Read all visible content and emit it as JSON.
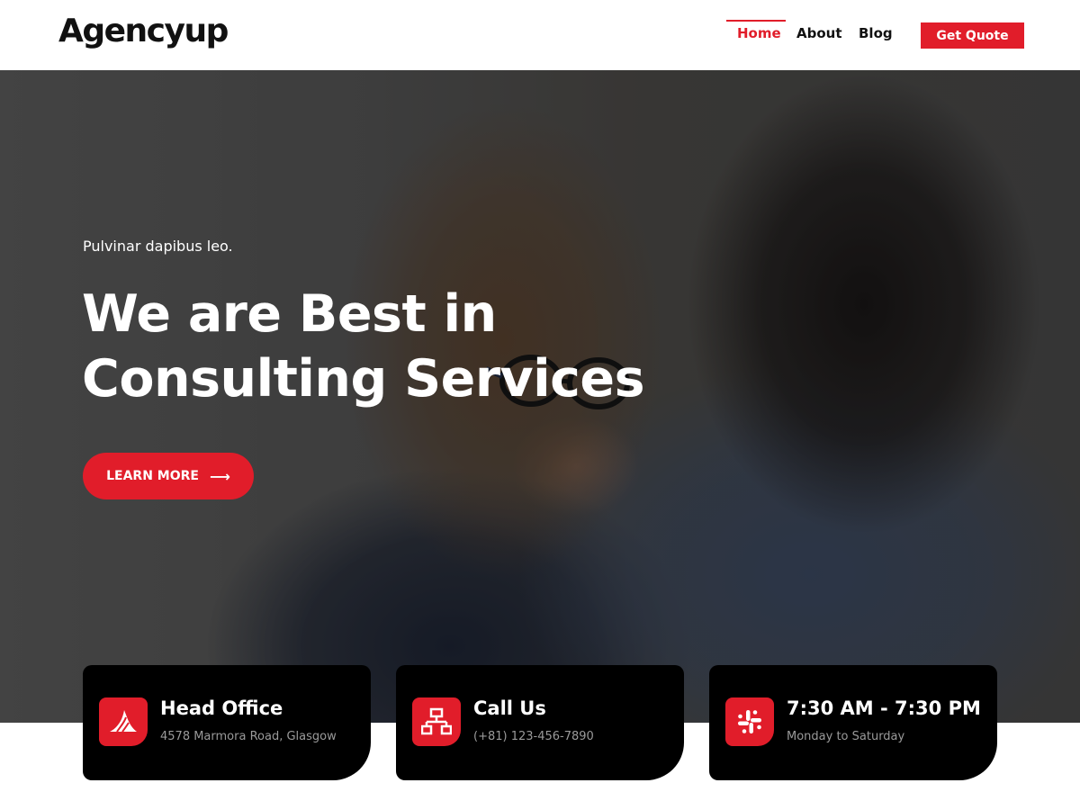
{
  "header": {
    "logo": "Agencyup",
    "nav": [
      {
        "label": "Home",
        "active": true
      },
      {
        "label": "About",
        "active": false
      },
      {
        "label": "Blog",
        "active": false
      }
    ],
    "cta_label": "Get Quote"
  },
  "hero": {
    "tagline": "Pulvinar dapibus leo.",
    "title": "We are Best in Consulting Services",
    "button_label": "LEARN MORE",
    "button_icon": "arrow-right-icon"
  },
  "cards": [
    {
      "icon": "shark-fin-icon",
      "title": "Head Office",
      "subtitle": "4578 Marmora Road, Glasgow"
    },
    {
      "icon": "network-icon",
      "title": "Call Us",
      "subtitle": "(+81) 123-456-7890"
    },
    {
      "icon": "slack-icon",
      "title": "7:30 AM - 7:30 PM",
      "subtitle": "Monday to Saturday"
    }
  ],
  "colors": {
    "accent": "#e11d2a",
    "card_background": "#000000",
    "card_subtitle": "#9a9a9a"
  }
}
